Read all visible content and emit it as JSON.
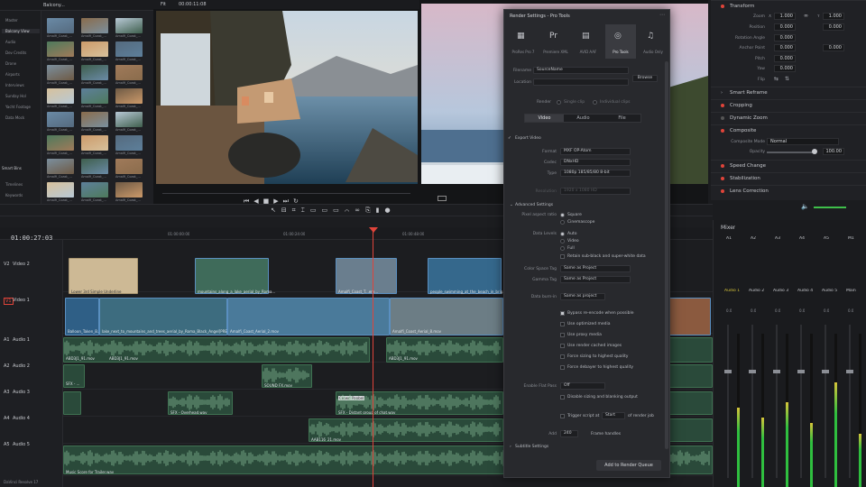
{
  "media_pool": {
    "bin_title": "Balcony...",
    "bins": [
      "Master",
      "Balcony View",
      "Audio",
      "Dev Credits",
      "Drone",
      "Airports",
      "Interviews",
      "Sunday Hol",
      "Yacht Footage",
      "Data Mock"
    ],
    "smart_bins_title": "Smart Bins",
    "smart_bins": [
      "Timelines",
      "Keywords"
    ],
    "clips": [
      "Amalfi_Coast_...",
      "Amalfi_Coast_...",
      "Amalfi_Coast_...",
      "Amalfi_Coast_...",
      "Amalfi_Coast_...",
      "Amalfi_Coast_...",
      "Amalfi_Coast_...",
      "Amalfi_Coast_...",
      "Amalfi_Coast_...",
      "Amalfi_Coast_...",
      "Amalfi_Coast_...",
      "Amalfi_Coast_...",
      "Amalfi_Coast_...",
      "Amalfi_Coast_...",
      "Amalfi_Coast_...",
      "Amalfi_Coast_...",
      "Amalfi_Coast_...",
      "Amalfi_Coast_...",
      "Amalfi_Coast_...",
      "Amalfi_Coast_...",
      "Amalfi_Coast_...",
      "Amalfi_Coast_...",
      "Amalfi_Coast_...",
      "Amalfi_Coast_..."
    ]
  },
  "viewer": {
    "fit": "Fit",
    "timecode": "00:00:11:08"
  },
  "inspector": {
    "transform": "Transform",
    "zoom_label": "Zoom",
    "zoom_x": "1.000",
    "zoom_y": "1.000",
    "position_label": "Position",
    "position_x": "0.000",
    "position_y": "0.000",
    "rotation_label": "Rotation Angle",
    "rotation": "0.000",
    "anchor_label": "Anchor Point",
    "anchor_x": "0.000",
    "anchor_y": "0.000",
    "pitch_label": "Pitch",
    "pitch": "0.000",
    "yaw_label": "Yaw",
    "yaw": "0.000",
    "flip_label": "Flip",
    "smart_reframe": "Smart Reframe",
    "cropping": "Cropping",
    "dynamic_zoom": "Dynamic Zoom",
    "composite": "Composite",
    "composite_mode_label": "Composite Mode",
    "composite_mode": "Normal",
    "opacity_label": "Opacity",
    "opacity": "100.00",
    "speed_change": "Speed Change",
    "stabilization": "Stabilization",
    "lens_correction": "Lens Correction"
  },
  "timeline": {
    "timecode": "01:00:27:03",
    "ruler": [
      "01:00:00:00",
      "01:00:24:00",
      "01:00:48:00"
    ],
    "tracks": [
      {
        "id": "V2",
        "name": "Video 2"
      },
      {
        "id": "V1",
        "name": "Video 1"
      },
      {
        "id": "A1",
        "name": "Audio 1"
      },
      {
        "id": "A2",
        "name": "Audio 2"
      },
      {
        "id": "A3",
        "name": "Audio 3"
      },
      {
        "id": "A4",
        "name": "Audio 4"
      },
      {
        "id": "A5",
        "name": "Audio 5"
      }
    ],
    "v2_clips": [
      "Lower 3rd Simple Underline",
      "mountains_along_a_lake_aerial_by_Roma...",
      "Amalfi_Coast_T...ere...",
      "people_swimming_at_the_beach_in_brig..."
    ],
    "v1_clips": [
      "Balloon_Taken_B...",
      "lake_next_to_mountains_and_trees_aerial_by_Roma_Black_Angel[PREMISE...",
      "Amalfi_Coast_Aerial_2.mov",
      "Amalfi_Coast_Aerial_8.mov"
    ],
    "a1_clips": [
      "ABD3J1_91.mov",
      "ABD3J1_91.mov",
      "ABD3J1_91.mov"
    ],
    "a2_clips": [
      "SFX - ...",
      "SOUND FX.mov"
    ],
    "a3_clips": [
      "SFX - Overhead.wav",
      "Crowd Panbel",
      "SFX - Distant group of chat.wav"
    ],
    "a4_clips": [
      "AAB116_21.mov"
    ],
    "a5_clips": [
      "Music Score for Trailer.wav",
      "Music Score for Trailer.wav"
    ]
  },
  "render": {
    "title": "Render Settings - Pro Tools",
    "presets": [
      "ProRes Pro 7",
      "Premiere XML",
      "AVID AAF",
      "Pro Tools",
      "Audio Only"
    ],
    "filename_label": "Filename",
    "filename": "SourceName",
    "location_label": "Location",
    "browse": "Browse",
    "render_label": "Render",
    "single_clip": "Single clip",
    "individual_clips": "Individual clips",
    "tabs": [
      "Video",
      "Audio",
      "File"
    ],
    "export_video": "Export Video",
    "format_label": "Format",
    "format": "MXF OP-Atom",
    "codec_label": "Codec",
    "codec": "DNxHD",
    "type_label": "Type",
    "type": "1080p 185/85/80 8-bit",
    "resolution_label": "Resolution",
    "resolution": "1920 x 1080 HD",
    "advanced_settings": "Advanced Settings",
    "pixel_aspect_label": "Pixel aspect ratio",
    "pixel_aspect_options": [
      "Square",
      "Cinemascope"
    ],
    "data_levels_label": "Data Levels",
    "data_levels_options": [
      "Auto",
      "Video",
      "Full"
    ],
    "retain_sub": "Retain sub-black and super-white data",
    "color_space_label": "Color Space Tag",
    "color_space": "Same as Project",
    "gamma_label": "Gamma Tag",
    "gamma": "Same as Project",
    "data_burn_label": "Data burn-in",
    "data_burn": "Same as project",
    "checks": [
      "Bypass re-encode when possible",
      "Use optimized media",
      "Use proxy media",
      "Use render cached images",
      "Force sizing to highest quality",
      "Force debayer to highest quality"
    ],
    "enable_flat_pass_label": "Enable Flat Pass",
    "enable_flat_pass": "Off",
    "disable_sizing": "Disable sizing and blanking output",
    "trigger_script": "Trigger script at",
    "trigger_when": "Start",
    "of_render_job": "of render job",
    "add_label": "Add",
    "add_frames": "240",
    "frame_handles": "Frame handles",
    "subtitle_settings": "Subtitle Settings",
    "add_to_queue": "Add to Render Queue"
  },
  "mixer": {
    "title": "Mixer",
    "channels": [
      "A1",
      "A2",
      "A3",
      "A4",
      "A5",
      "M1"
    ],
    "names": [
      "Audio 1",
      "Audio 2",
      "Audio 3",
      "Audio 4",
      "Audio 5",
      "Main"
    ],
    "values": [
      "0.0",
      "0.0",
      "0.0",
      "0.0",
      "0.0",
      "0.0"
    ],
    "levels": [
      0.52,
      0.45,
      0.55,
      0.42,
      0.68,
      0.35
    ]
  },
  "status": {
    "app": "DaVinci Resolve 17"
  }
}
